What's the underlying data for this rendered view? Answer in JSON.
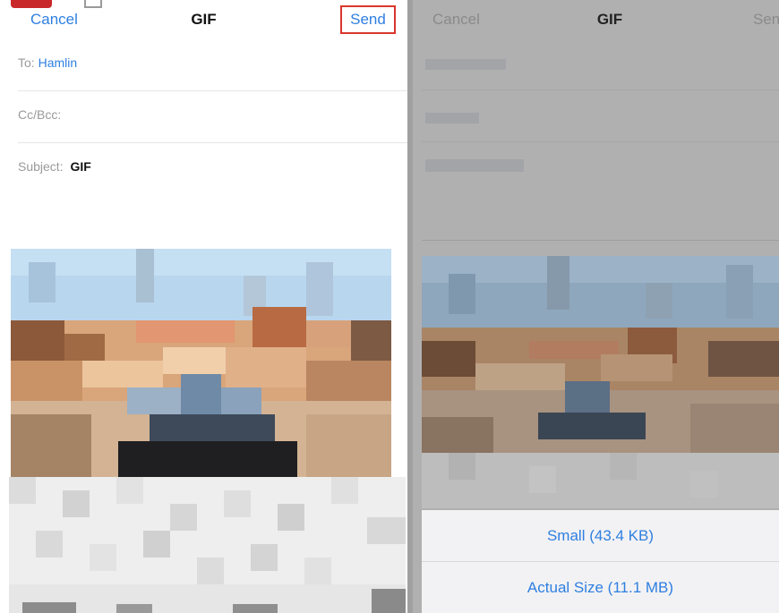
{
  "left_panel": {
    "nav": {
      "cancel": "Cancel",
      "title": "GIF",
      "send": "Send"
    },
    "fields": {
      "to_label": "To:",
      "to_value": "Hamlin",
      "cc_label": "Cc/Bcc:",
      "subject_label": "Subject:",
      "subject_value": "GIF"
    },
    "highlight_color": "#d9362c"
  },
  "right_panel": {
    "nav": {
      "cancel": "Cancel",
      "title": "GIF",
      "send": "Send"
    },
    "size_options": [
      "Small (43.4 KB)",
      "Actual Size (11.1 MB)"
    ]
  },
  "accent_color": "#2f7fe0"
}
